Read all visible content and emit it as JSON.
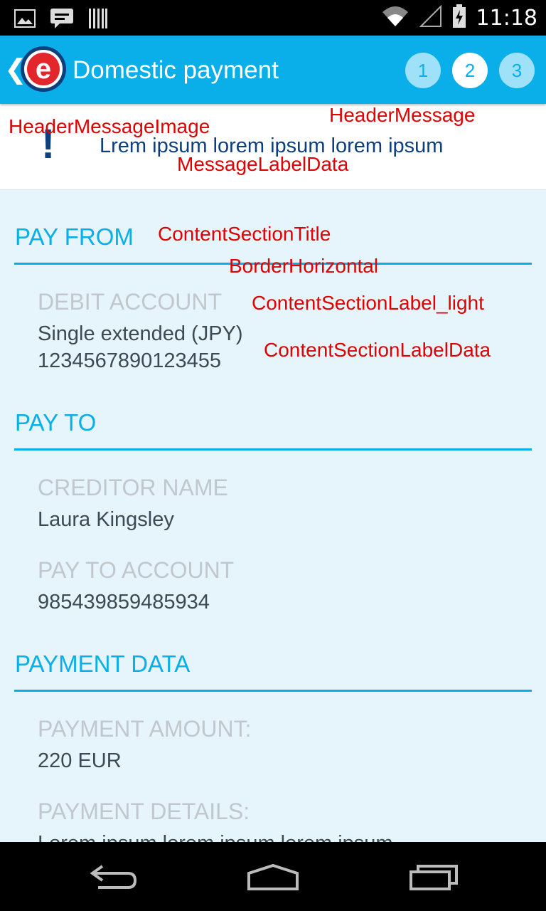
{
  "status_bar": {
    "time": "11:18",
    "icons": [
      "image-icon",
      "chat-icon",
      "barcode-icon",
      "wifi-icon",
      "signal-icon",
      "battery-charging-icon"
    ]
  },
  "app_bar": {
    "title": "Domestic payment",
    "logo_letter": "e",
    "steps": [
      {
        "label": "1",
        "state": "inactive"
      },
      {
        "label": "2",
        "state": "active"
      },
      {
        "label": "3",
        "state": "inactive"
      }
    ]
  },
  "header_message": {
    "icon": "!",
    "text": "Lrem ipsum lorem ipsum lorem ipsum"
  },
  "dev_labels": {
    "header_message": "HeaderMessage",
    "header_message_image": "HeaderMessageImage",
    "message_label_data": "MessageLabelData",
    "content_section_title": "ContentSectionTitle",
    "border_horizontal": "BorderHorizontal",
    "content_section_label_light": "ContentSectionLabel_light",
    "content_section_label_data": "ContentSectionLabelData"
  },
  "sections": {
    "pay_from": {
      "title": "PAY FROM",
      "debit_account_label": "DEBIT ACCOUNT",
      "debit_account_name": "Single extended (JPY)",
      "debit_account_number": "1234567890123455"
    },
    "pay_to": {
      "title": "PAY TO",
      "creditor_name_label": "CREDITOR NAME",
      "creditor_name": "Laura Kingsley",
      "pay_to_account_label": "PAY TO ACCOUNT",
      "pay_to_account": "985439859485934"
    },
    "payment_data": {
      "title": "PAYMENT DATA",
      "amount_label": "PAYMENT AMOUNT:",
      "amount": "220 EUR",
      "details_label": "PAYMENT DETAILS:",
      "details": "Lorem ipsum lorem ipsum lorem ipsum"
    }
  },
  "colors": {
    "primary": "#0aaee9",
    "message_text": "#0d3f7d",
    "logo_red": "#e3262b",
    "content_bg": "#e6f4fb",
    "annotation": "#e00000"
  }
}
